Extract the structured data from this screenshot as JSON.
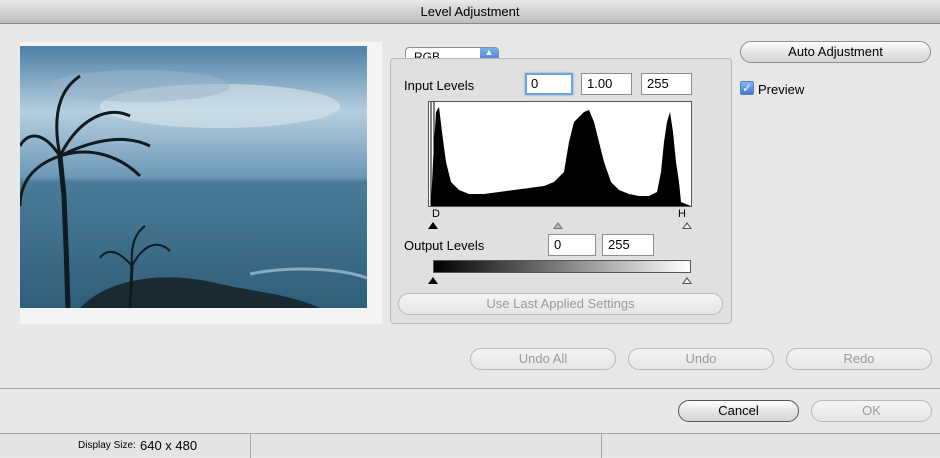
{
  "window": {
    "title": "Level Adjustment"
  },
  "channel_select": {
    "value": "RGB"
  },
  "input_levels": {
    "label": "Input Levels",
    "black": "0",
    "gamma": "1.00",
    "white": "255"
  },
  "histogram": {
    "shadow_label": "D",
    "highlight_label": "H"
  },
  "output_levels": {
    "label": "Output Levels",
    "black": "0",
    "white": "255"
  },
  "buttons": {
    "use_last": "Use Last Applied Settings",
    "auto": "Auto Adjustment",
    "undo_all": "Undo All",
    "undo": "Undo",
    "redo": "Redo",
    "cancel": "Cancel",
    "ok": "OK"
  },
  "preview": {
    "label": "Preview",
    "checked": true
  },
  "status": {
    "display_size_label": "Display Size:",
    "display_size_value": "640 x 480"
  },
  "colors": {
    "accent": "#3d78d6",
    "disabled_text": "#9a9a9a"
  }
}
